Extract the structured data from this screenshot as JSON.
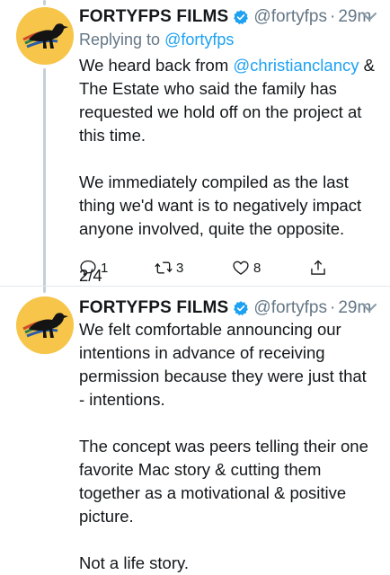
{
  "tweets": [
    {
      "name": "FORTYFPS FILMS",
      "handle": "@fortyfps",
      "separator": "·",
      "time": "29m",
      "reply_prefix": "Replying to ",
      "reply_to": "@fortyfps",
      "text_p1_a": "We heard back from ",
      "text_p1_mention": "@christianclancy",
      "text_p1_b": " & The Estate who said the family has requested we hold off on the project at this time.",
      "text_p2": "We immediately compiled as the last thing we'd want is to negatively impact anyone involved, quite the opposite.",
      "text_p3": "2/4",
      "replies": "1",
      "retweets": "3",
      "likes": "8"
    },
    {
      "name": "FORTYFPS FILMS",
      "handle": "@fortyfps",
      "separator": "·",
      "time": "29m",
      "text_p1": "We felt comfortable announcing our intentions in advance of receiving permission because they were just that - intentions.",
      "text_p2": "The concept was peers telling their one favorite Mac story & cutting them together as a motivational & positive picture.",
      "text_p3": "Not a life story."
    }
  ],
  "colors": {
    "accent": "#1da1f2",
    "secondary_text": "#657786",
    "avatar_bg": "#f6c54a",
    "thread_line": "#c4cfd6"
  },
  "icons": [
    "bird-logo",
    "verified-badge-icon",
    "chevron-down-icon",
    "reply-icon",
    "retweet-icon",
    "like-icon",
    "share-icon"
  ]
}
